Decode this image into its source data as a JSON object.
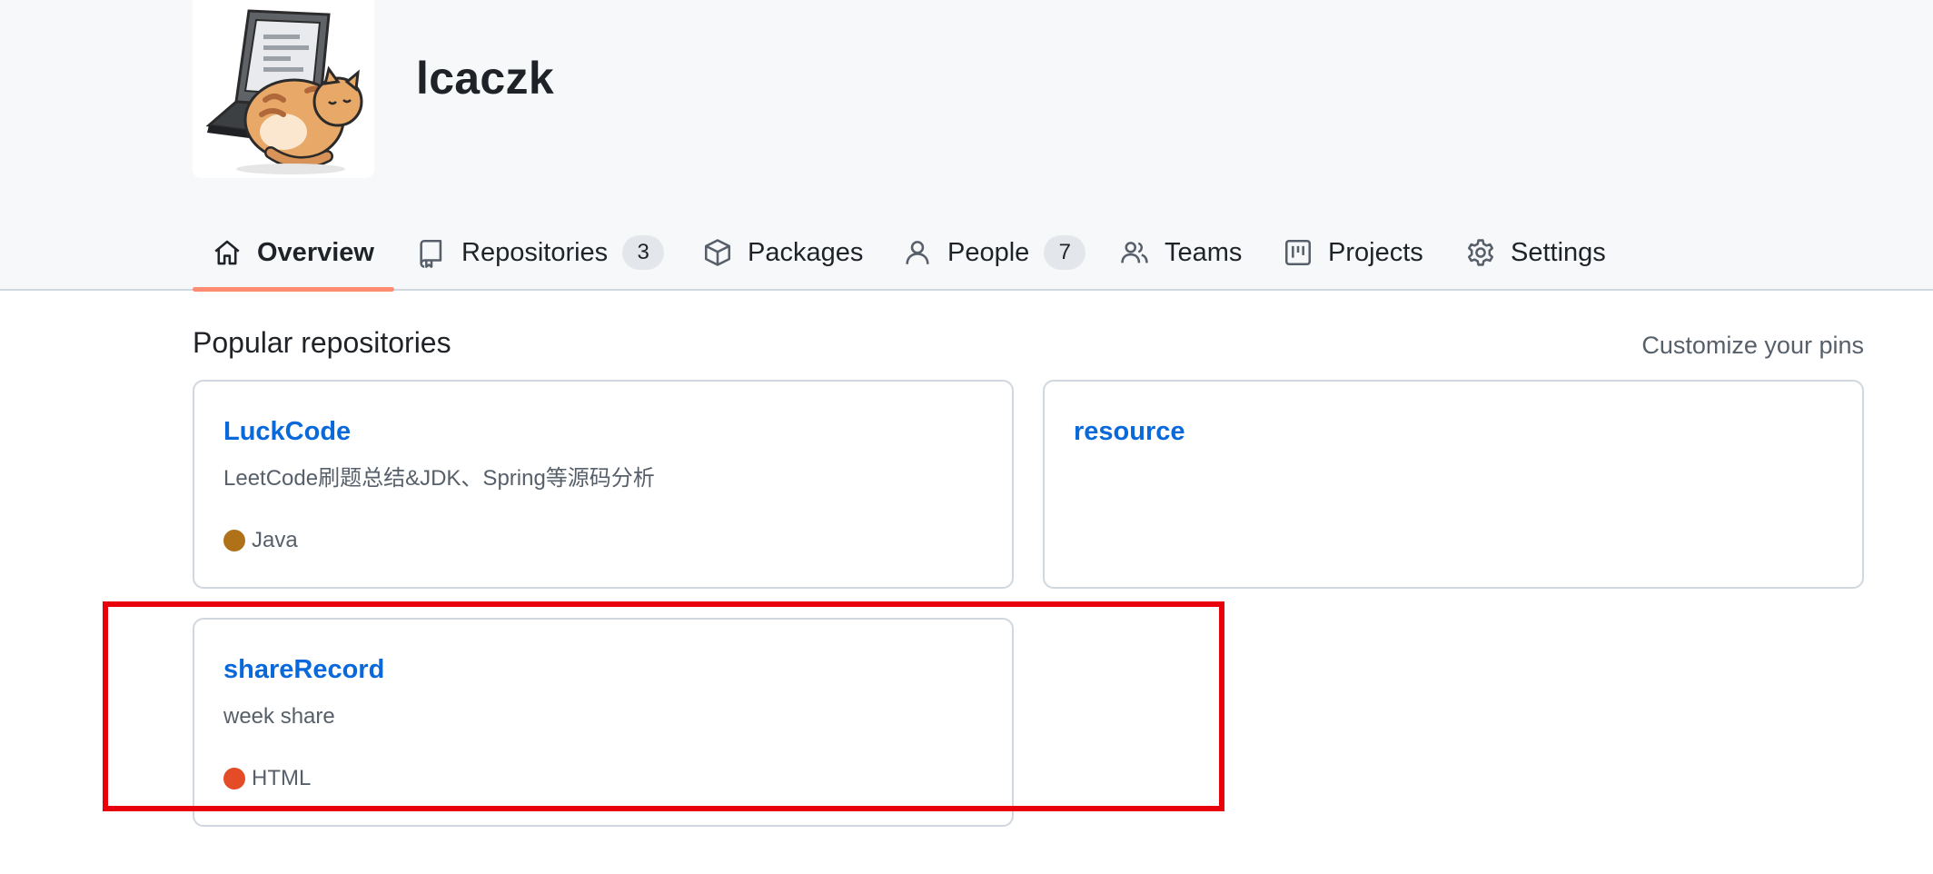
{
  "org": {
    "name": "lcaczk"
  },
  "nav": {
    "tabs": [
      {
        "label": "Overview",
        "icon": "home-icon",
        "selected": true
      },
      {
        "label": "Repositories",
        "icon": "repo-icon",
        "count": "3"
      },
      {
        "label": "Packages",
        "icon": "package-icon"
      },
      {
        "label": "People",
        "icon": "person-icon",
        "count": "7"
      },
      {
        "label": "Teams",
        "icon": "people-icon"
      },
      {
        "label": "Projects",
        "icon": "project-icon"
      },
      {
        "label": "Settings",
        "icon": "gear-icon"
      }
    ]
  },
  "popular": {
    "title": "Popular repositories",
    "customize_label": "Customize your pins",
    "repos": [
      {
        "name": "LuckCode",
        "description": "LeetCode刷题总结&JDK、Spring等源码分析",
        "language": "Java",
        "language_color": "#b07219"
      },
      {
        "name": "resource",
        "description": "",
        "language": "",
        "language_color": ""
      },
      {
        "name": "shareRecord",
        "description": "week share",
        "language": "HTML",
        "language_color": "#e34c26"
      }
    ]
  },
  "colors": {
    "accent_underline": "#fd8c73",
    "link": "#0969da",
    "highlight": "#e8000b"
  }
}
